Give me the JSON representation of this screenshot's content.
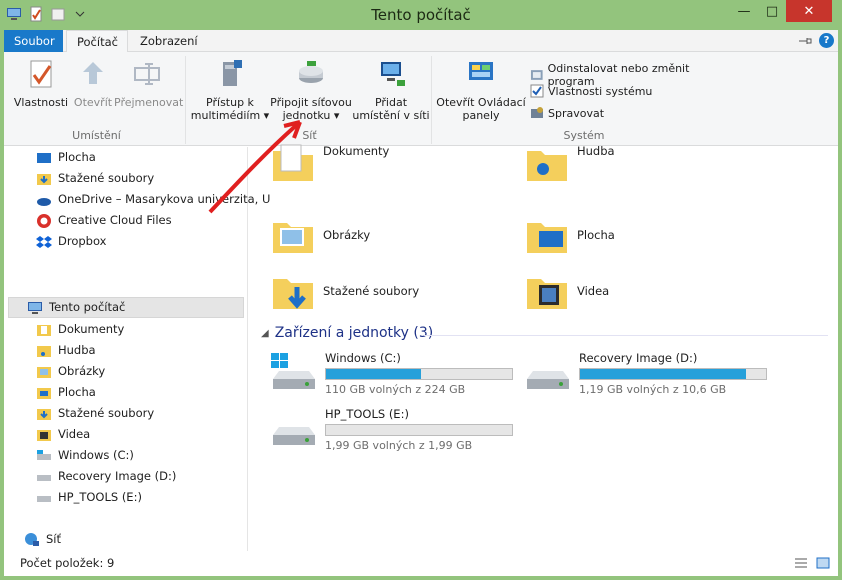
{
  "window": {
    "title": "Tento počítač"
  },
  "tabs": {
    "file": "Soubor",
    "computer": "Počítač",
    "view": "Zobrazení"
  },
  "ribbon": {
    "location": {
      "label": "Umístění",
      "properties": "Vlastnosti",
      "open": "Otevřít",
      "rename": "Přejmenovat"
    },
    "network": {
      "label": "Síť",
      "media_line1": "Přístup k",
      "media_line2": "multimédiím",
      "map_line1": "Připojit síťovou",
      "map_line2": "jednotku",
      "add_line1": "Přidat",
      "add_line2": "umístění v síti"
    },
    "system": {
      "label": "Systém",
      "control_line1": "Otevřít Ovládací",
      "control_line2": "panely",
      "uninstall": "Odinstalovat nebo změnit program",
      "sysprops": "Vlastnosti systému",
      "manage": "Spravovat"
    }
  },
  "nav": {
    "items": [
      "Plocha",
      "Stažené soubory",
      "OneDrive – Masarykova univerzita, U",
      "Creative Cloud Files",
      "Dropbox",
      "Tento počítač",
      "Dokumenty",
      "Hudba",
      "Obrázky",
      "Plocha",
      "Stažené soubory",
      "Videa",
      "Windows (C:)",
      "Recovery Image (D:)",
      "HP_TOOLS (E:)",
      "Síť"
    ]
  },
  "folders": [
    "Dokumenty",
    "Hudba",
    "Obrázky",
    "Plocha",
    "Stažené soubory",
    "Videa"
  ],
  "devices": {
    "heading": "Zařízení a jednotky (3)",
    "drives": [
      {
        "name": "Windows (C:)",
        "free": "110 GB volných z 224 GB",
        "used_fraction": 0.51
      },
      {
        "name": "Recovery Image (D:)",
        "free": "1,19 GB volných z 10,6 GB",
        "used_fraction": 0.89
      },
      {
        "name": "HP_TOOLS (E:)",
        "free": "1,99 GB volných z 1,99 GB",
        "used_fraction": 0.0
      }
    ]
  },
  "status": {
    "count": "Počet položek: 9"
  },
  "colors": {
    "accent": "#1979ca",
    "frame": "#93c47d",
    "bar": "#26a0da",
    "arrow": "#e02020"
  }
}
